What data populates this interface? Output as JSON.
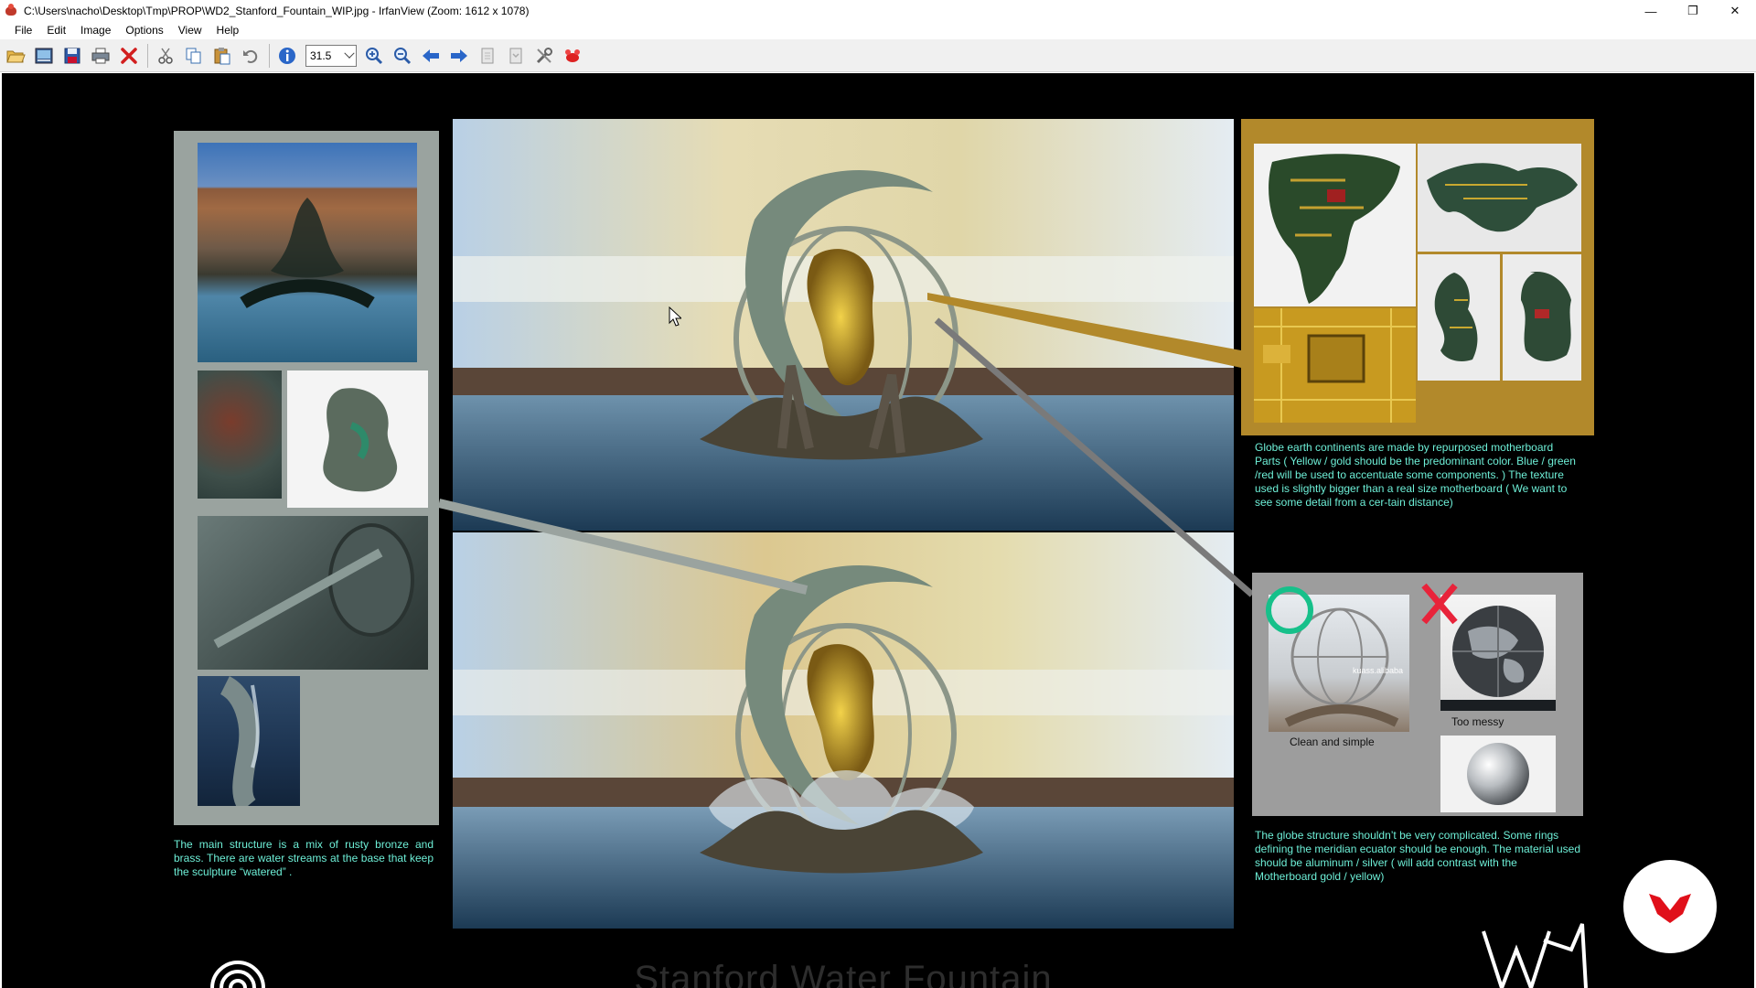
{
  "window": {
    "title": "C:\\Users\\nacho\\Desktop\\Tmp\\PROP\\WD2_Stanford_Fountain_WIP.jpg - IrfanView (Zoom: 1612 x 1078)",
    "minimize": "—",
    "restore": "❐",
    "close": "✕"
  },
  "menu": [
    "File",
    "Edit",
    "Image",
    "Options",
    "View",
    "Help"
  ],
  "toolbar": {
    "zoom_value": "31.5",
    "icons": [
      "open-icon",
      "thumbnails-icon",
      "save-icon",
      "print-icon",
      "delete-icon",
      "cut-icon",
      "copy-icon",
      "paste-icon",
      "undo-icon",
      "info-icon",
      "zoom-in-icon",
      "zoom-out-icon",
      "previous-icon",
      "next-icon",
      "page-first-icon",
      "page-next-icon",
      "settings-icon",
      "irfanview-icon"
    ]
  },
  "image": {
    "caption_left": "The main structure is a mix of rusty bronze and brass. There are water streams at the base that keep the sculpture “watered” .",
    "caption_top_right": "Globe earth continents are made by repurposed motherboard Parts ( Yellow / gold should be the predominant color. Blue / green /red will be used to accentuate some components. ) The texture used is slightly  bigger than a real size motherboard ( We want to see some detail from a cer-tain distance)",
    "caption_bottom_right": "The globe structure shouldn’t be very complicated. Some rings defining the meridian ecuator should be enough. The material used should be aluminum / silver ( will add contrast with the Motherboard gold / yellow)",
    "good_label": "Clean  and  simple",
    "bad_label": "Too  messy",
    "watermark": "kuass.alibaba",
    "title": "Stanford Water Fountain"
  },
  "colors": {
    "caption": "#6ef0d8",
    "gold_panel": "#b2892b",
    "good_mark": "#16c08a",
    "bad_mark": "#e8233a"
  }
}
